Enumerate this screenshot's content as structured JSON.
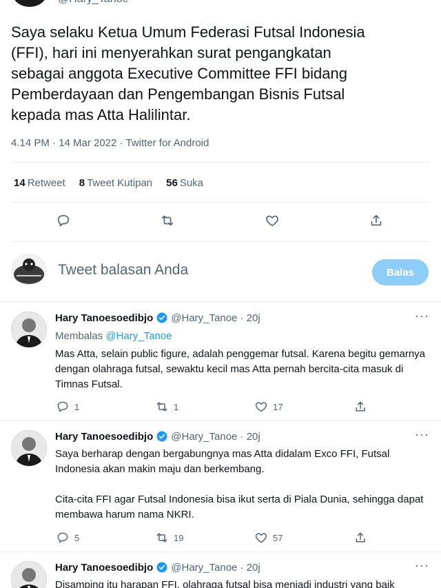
{
  "top": {
    "handle": "@Hary_Tanoe"
  },
  "main_tweet": {
    "text": "Saya selaku Ketua Umum Federasi Futsal Indonesia\n(FFI), hari ini menyerahkan surat pengangkatan\nsebagai anggota Executive Committee FFI bidang\nPemberdayaan dan Pengembangan Bisnis Futsal\nkepada mas Atta Halilintar.",
    "meta": "4.14 PM · 14 Mar 2022 · Twitter for Android",
    "stats": [
      {
        "count": "14",
        "label": "Retweet"
      },
      {
        "count": "8",
        "label": "Tweet Kutipan"
      },
      {
        "count": "56",
        "label": "Suka"
      }
    ],
    "action_icons": [
      "reply-icon",
      "retweet-icon",
      "like-icon",
      "share-icon"
    ]
  },
  "compose": {
    "placeholder": "Tweet balasan Anda",
    "button": "Balas"
  },
  "replies": [
    {
      "name": "Hary Tanoesoedibjo",
      "handle": "@Hary_Tanoe · 20j",
      "replying_prefix": "Membalas ",
      "replying_to": "@Hary_Tanoe",
      "text": "Mas Atta, selain public figure, adalah penggemar futsal. Karena begitu gemarnya dengan olahraga futsal, sewaktu kecil mas Atta  pernah bercita-cita masuk di Timnas Futsal.",
      "replies": "1",
      "retweets": "1",
      "likes": "17"
    },
    {
      "name": "Hary Tanoesoedibjo",
      "handle": "@Hary_Tanoe · 20j",
      "text": "Saya berharap dengan bergabungnya mas Atta didalam Exco FFI, Futsal Indonesia akan makin maju dan berkembang.\n\nCita-cita FFI agar Futsal Indonesia bisa ikut serta di Piala Dunia, sehingga dapat membawa harum nama NKRI.",
      "replies": "5",
      "retweets": "19",
      "likes": "57"
    },
    {
      "name": "Hary Tanoesoedibjo",
      "handle": "@Hary_Tanoe · 20j",
      "text": "Disamping itu harapan FFI, olahraga futsal bisa menjadi industri yang baik"
    }
  ],
  "colors": {
    "accent": "#1d9bf0",
    "reply_button": "#8ecdf8",
    "muted": "#536471"
  }
}
